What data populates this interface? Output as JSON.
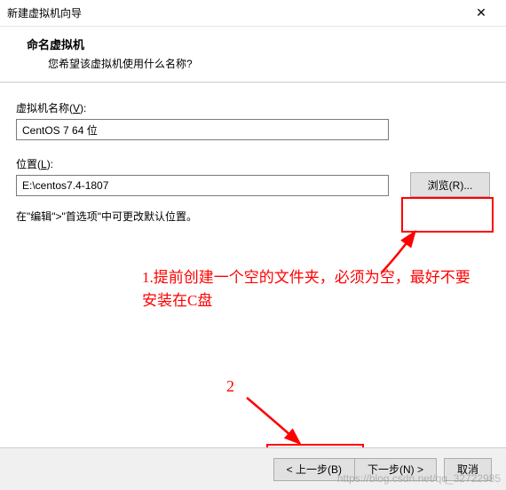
{
  "window": {
    "title": "新建虚拟机向导",
    "close_icon": "✕"
  },
  "header": {
    "heading": "命名虚拟机",
    "subheading": "您希望该虚拟机使用什么名称?"
  },
  "fields": {
    "name_label_prefix": "虚拟机名称(",
    "name_label_key": "V",
    "name_label_suffix": "):",
    "name_value": "CentOS 7 64 位",
    "location_label_prefix": "位置(",
    "location_label_key": "L",
    "location_label_suffix": "):",
    "location_value": "E:\\centos7.4-1807",
    "browse_label": "浏览(R)..."
  },
  "hint": "在\"编辑\">\"首选项\"中可更改默认位置。",
  "annotations": {
    "note1": "1.提前创建一个空的文件夹，必须为空，最好不要安装在C盘",
    "note2": "2"
  },
  "footer": {
    "back": "< 上一步(B)",
    "next": "下一步(N) >",
    "cancel": "取消"
  },
  "watermark": "https://blog.csdn.net/qq_32722985"
}
